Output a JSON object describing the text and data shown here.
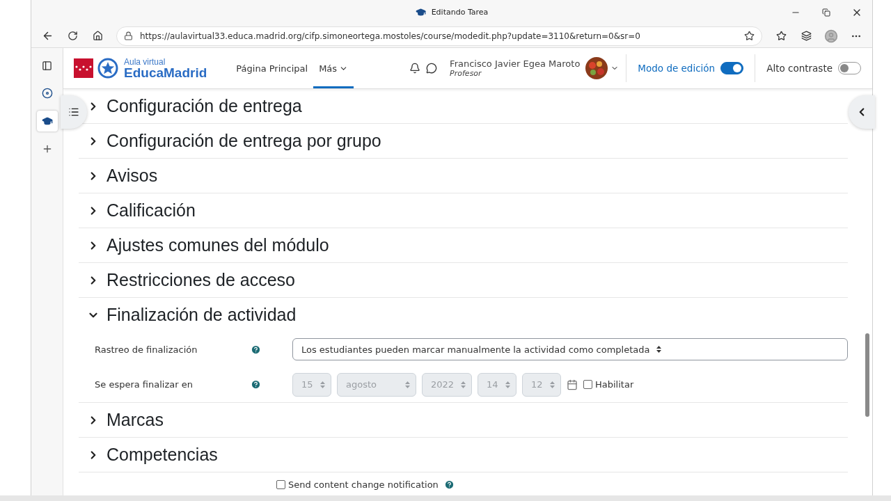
{
  "window": {
    "title": "Editando Tarea"
  },
  "browser": {
    "url": "https://aulavirtual33.educa.madrid.org/cifp.simoneortega.mostoles/course/modedit.php?update=3110&return=0&sr=0"
  },
  "header": {
    "logo": {
      "small": "Aula virtual",
      "big": "EducaMadrid"
    },
    "nav": [
      {
        "label": "Página Principal",
        "selected": false,
        "dropdown": false
      },
      {
        "label": "Más",
        "selected": true,
        "dropdown": true
      }
    ],
    "user": {
      "name": "Francisco Javier Egea Maroto",
      "role": "Profesor"
    },
    "toggles": [
      {
        "label": "Modo de edición",
        "on": true
      },
      {
        "label": "Alto contraste",
        "on": false
      }
    ]
  },
  "sections": [
    {
      "title": "Configuración de entrega",
      "expanded": false
    },
    {
      "title": "Configuración de entrega por grupo",
      "expanded": false
    },
    {
      "title": "Avisos",
      "expanded": false
    },
    {
      "title": "Calificación",
      "expanded": false
    },
    {
      "title": "Ajustes comunes del módulo",
      "expanded": false
    },
    {
      "title": "Restricciones de acceso",
      "expanded": false
    },
    {
      "title": "Finalización de actividad",
      "expanded": true,
      "fields": [
        {
          "kind": "select",
          "label": "Rastreo de finalización",
          "value": "Los estudiantes pueden marcar manualmente la actividad como completada"
        },
        {
          "kind": "date",
          "label": "Se espera finalizar en",
          "disabled": true,
          "parts": [
            "15",
            "agosto",
            "2022",
            "14",
            "12"
          ],
          "enable": {
            "label": "Habilitar",
            "checked": false
          }
        }
      ]
    },
    {
      "title": "Marcas",
      "expanded": false
    },
    {
      "title": "Competencias",
      "expanded": false
    }
  ],
  "notification": {
    "label": "Send content change notification",
    "checked": false
  }
}
